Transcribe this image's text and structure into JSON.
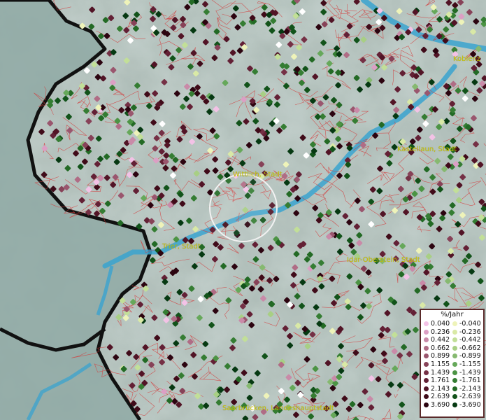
{
  "map": {
    "cities": [
      {
        "label": "Koblenz"
      },
      {
        "label": "Wittlich, Stadt"
      },
      {
        "label": "Kastellaun, Stadt"
      },
      {
        "label": "Trier, Stadt"
      },
      {
        "label": "Idar-Oberstein, Stadt"
      },
      {
        "label": "Saarbrücken, Landeshauptstadt"
      }
    ],
    "colors": {
      "land": "#a7b6b1",
      "sea": "#7fa3a3",
      "river": "#3aa3cf",
      "borders": "#d43a3a",
      "country_border": "#111111",
      "label": "#c8c400"
    }
  },
  "legend": {
    "title": "%/Jahr",
    "rows": [
      {
        "pos": "0.040",
        "neg": "-0.040",
        "pos_color": "#f3c2e6",
        "neg_color": "#eef3b9"
      },
      {
        "pos": "0.236",
        "neg": "-0.236",
        "pos_color": "#dc9fc4",
        "neg_color": "#d9e9a6"
      },
      {
        "pos": "0.442",
        "neg": "-0.442",
        "pos_color": "#c98aa8",
        "neg_color": "#c2df98"
      },
      {
        "pos": "0.662",
        "neg": "-0.662",
        "pos_color": "#b06c85",
        "neg_color": "#a8cf84"
      },
      {
        "pos": "0.899",
        "neg": "-0.899",
        "pos_color": "#9a566e",
        "neg_color": "#86b970"
      },
      {
        "pos": "1.155",
        "neg": "-1.155",
        "pos_color": "#874258",
        "neg_color": "#66a85a"
      },
      {
        "pos": "1.439",
        "neg": "-1.439",
        "pos_color": "#753045",
        "neg_color": "#4c9444"
      },
      {
        "pos": "1.761",
        "neg": "-1.761",
        "pos_color": "#632035",
        "neg_color": "#357d33"
      },
      {
        "pos": "2.143",
        "neg": "-2.143",
        "pos_color": "#521426",
        "neg_color": "#236a25"
      },
      {
        "pos": "2.639",
        "neg": "-2.639",
        "pos_color": "#400b19",
        "neg_color": "#12531a"
      },
      {
        "pos": "3.690",
        "neg": "-3.690",
        "pos_color": "#2c0410",
        "neg_color": "#063912"
      }
    ]
  }
}
